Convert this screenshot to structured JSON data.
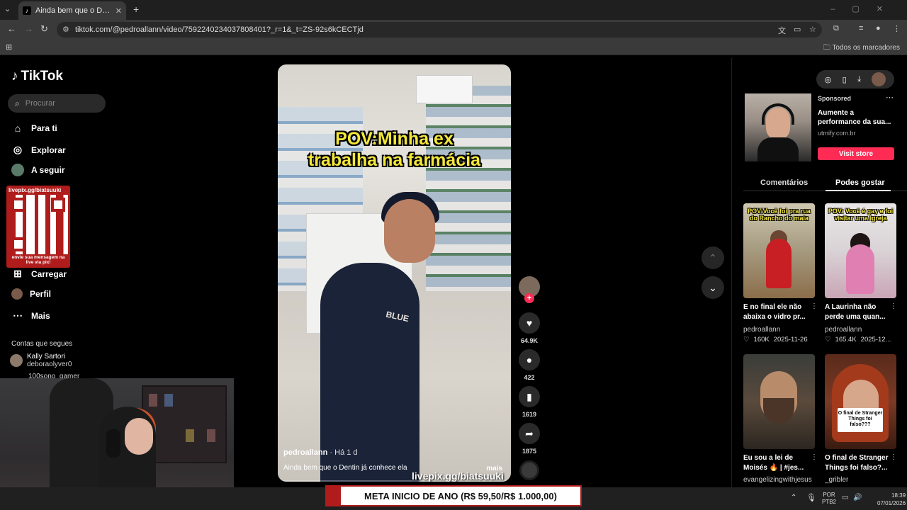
{
  "browser": {
    "tab_title": "Ainda bem que o Dentin já conhece ela",
    "url": "tiktok.com/@pedroallann/video/7592240234037808401?_r=1&_t=ZS-92s6kCECTjd",
    "bookmarks_all": "Todos os marcadores"
  },
  "tiktok": {
    "logo": "TikTok",
    "search_placeholder": "Procurar",
    "nav": {
      "for_you": "Para ti",
      "explore": "Explorar",
      "following": "A seguir",
      "upload": "Carregar",
      "profile": "Perfil",
      "more": "Mais"
    },
    "following_header": "Contas que segues",
    "accounts": [
      {
        "name": "Kally Sartori",
        "handle": "deboraolyver0"
      },
      {
        "name": "100sono_gamer"
      }
    ]
  },
  "qr_overlay": {
    "url": "livepix.gg/biatsuuki",
    "message": "envie sua mensagem na live via pix!"
  },
  "video": {
    "caption_line1": "POV:Minha ex",
    "caption_line2": "trabalha na farmácia",
    "author": "pedroallann",
    "age": " · Há 1 d",
    "description": "Ainda bem que o Dentin já conhece ela",
    "more": "mais",
    "shirt_text": "BLUE"
  },
  "stream_overlay": {
    "livepix": "livepix.gg/biatsuuki",
    "goal": "META INICIO DE ANO (R$ 59,50/R$ 1.000,00)"
  },
  "actions": {
    "likes": "64.9K",
    "comments": "422",
    "saves": "1619",
    "shares": "1875"
  },
  "ad": {
    "sponsored": "Sponsored",
    "title": "Aumente a performance da sua...",
    "domain": "utmify.com.br",
    "cta": "Visit store"
  },
  "right_tabs": {
    "comments": "Comentários",
    "suggested": "Podes gostar"
  },
  "suggestions": [
    {
      "thumb_caption": "POV:Você foi pra rua do Rancho do maia",
      "title": "E no final ele não abaixa o vidro pr...",
      "author": "pedroallann",
      "likes": "160K",
      "date": "2025-11-26"
    },
    {
      "thumb_caption": "POV: Você é gay e foi visitar uma igreja",
      "title": "A Laurinha não perde uma quan...",
      "author": "pedroallann",
      "likes": "165.4K",
      "date": "2025-12..."
    },
    {
      "thumb_caption": "",
      "title": "Eu sou a lei de Moisés 🔥 | #jes...",
      "author": "evangelizingwithjesus"
    },
    {
      "thumb_caption": "O final de Stranger Things foi falso???",
      "title": "O final de Stranger Things foi falso?...",
      "author": "_gribler"
    }
  ],
  "taskbar": {
    "lang_line1": "POR",
    "lang_line2": "PTB2",
    "time": "18:39",
    "date": "07/01/2026"
  }
}
